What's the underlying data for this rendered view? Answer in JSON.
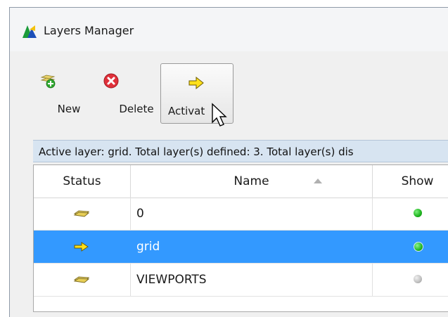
{
  "window": {
    "title": "Layers Manager"
  },
  "toolbar": {
    "new_label": "New",
    "delete_label": "Delete",
    "activate_label": "Activat"
  },
  "status_text": "Active layer: grid. Total layer(s) defined: 3. Total layer(s) dis",
  "table": {
    "columns": [
      "Status",
      "Name",
      "Show"
    ],
    "rows": [
      {
        "status_icon": "folder-icon",
        "name": "0",
        "show": "green",
        "selected": false
      },
      {
        "status_icon": "arrow-right-icon",
        "name": "grid",
        "show": "green",
        "selected": true
      },
      {
        "status_icon": "folder-icon",
        "name": "VIEWPORTS",
        "show": "gray",
        "selected": false
      }
    ]
  },
  "colors": {
    "selection": "#3399ff",
    "status_bar": "#d7e4f1",
    "show_on": "#1db31d",
    "show_off": "#bfbfbf"
  }
}
